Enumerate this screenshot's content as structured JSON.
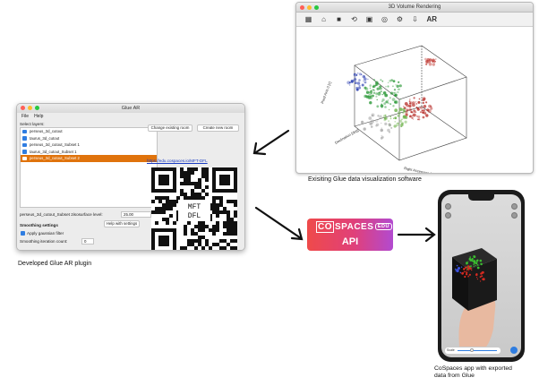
{
  "vr_window": {
    "title": "3D Volume Rendering",
    "toolbar_icons": [
      "display-mode-icon",
      "home-icon",
      "camera-icon",
      "rotate-icon",
      "save-icon",
      "reset-icon",
      "settings-icon",
      "export-icon",
      "ar-icon"
    ],
    "ar_label": "AR",
    "axis_labels": {
      "x": "Right Ascension [deg]",
      "y": "Declination [deg]",
      "z": "Pixel Axis 0 [z]"
    }
  },
  "captions": {
    "vr": "Exisiting Glue data visualization software",
    "glue": "Developed Glue AR plugin",
    "phone_line1": "CoSpaces app with exported",
    "phone_line2": "data from Glue"
  },
  "glue_window": {
    "title": "Glue AR",
    "menu": [
      "File",
      "Help"
    ],
    "select_layers_label": "Select layers:",
    "layers": [
      {
        "name": "perseus_3d_cutout",
        "selected": false
      },
      {
        "name": "taurus_3d_cutout",
        "selected": false
      },
      {
        "name": "perseus_3d_cutout_Subset 1",
        "selected": false
      },
      {
        "name": "taurus_3d_cutout_Subset 1",
        "selected": false
      },
      {
        "name": "perseus_3d_cutout_Subset 2",
        "selected": true
      }
    ],
    "isosurface_label": "perseus_3d_cutout_Subset 2isosurface level:",
    "isosurface_value": "25.00",
    "smoothing_heading": "Smoothing settings",
    "help_button": "Help with settings",
    "gaussian_label": "Apply gaussian filter",
    "iteration_label": "Smoothing iteration count:",
    "iteration_value": "0",
    "change_room_button": "Change existing room",
    "create_room_button": "Create new room",
    "room_link": "https://edu.cospaces.io/MFT-DFL",
    "qr_text_line1": "MFT",
    "qr_text_line2": "DFL"
  },
  "api_badge": {
    "logo_co": "CO",
    "logo_spaces": "SPACES",
    "logo_edu": "EDU",
    "label": "API"
  },
  "phone": {
    "slider_label": "Scale",
    "slider_value": 0.5
  },
  "colors": {
    "selected_layer": "#e0730c",
    "checkbox": "#2f7de1",
    "api_gradient_start": "#ef4a4a",
    "api_gradient_end": "#b24ad0"
  }
}
